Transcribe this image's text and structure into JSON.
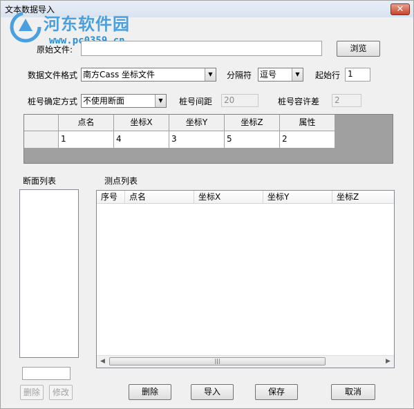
{
  "window": {
    "title": "文本数据导入",
    "close_label": "✕"
  },
  "watermark": {
    "site_name": "河东软件园",
    "url": "www.pc0359.cn"
  },
  "source_file": {
    "label": "原始文件:",
    "value": "",
    "browse_label": "浏览"
  },
  "format": {
    "label": "数据文件格式",
    "value": "南方Cass 坐标文件",
    "delimiter_label": "分隔符",
    "delimiter_value": "逗号",
    "start_row_label": "起始行",
    "start_row_value": "1"
  },
  "station": {
    "method_label": "桩号确定方式",
    "method_value": "不使用断面",
    "interval_label": "桩号间距",
    "interval_value": "20",
    "tolerance_label": "桩号容许差",
    "tolerance_value": "2"
  },
  "mapping_grid": {
    "headers": [
      "点名",
      "坐标X",
      "坐标Y",
      "坐标Z",
      "属性"
    ],
    "values": [
      "1",
      "4",
      "3",
      "5",
      "2"
    ]
  },
  "section_list": {
    "label": "断面列表",
    "input_value": ""
  },
  "point_list": {
    "label": "测点列表",
    "columns": [
      "序号",
      "点名",
      "坐标X",
      "坐标Y",
      "坐标Z"
    ],
    "scroll_grip": "|||"
  },
  "buttons": {
    "delete_section": "删除",
    "edit_section": "修改",
    "delete": "删除",
    "import": "导入",
    "save": "保存",
    "cancel": "取消"
  }
}
